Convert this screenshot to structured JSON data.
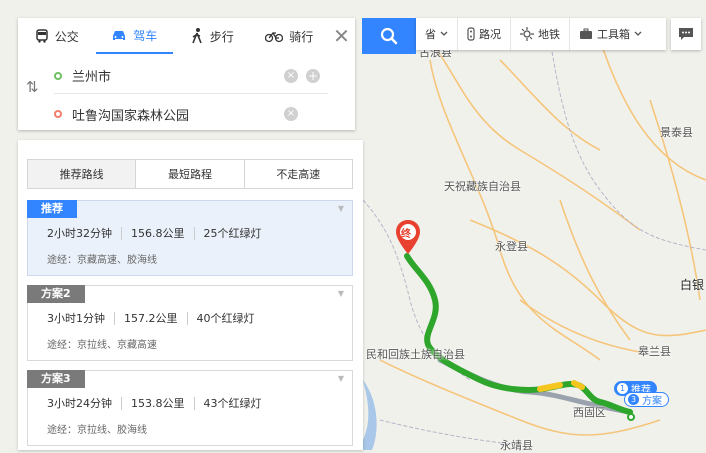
{
  "map": {
    "places": [
      {
        "name": "古浪县",
        "kind": "county"
      },
      {
        "name": "景泰县",
        "kind": "county"
      },
      {
        "name": "天祝藏族自治县",
        "kind": "county"
      },
      {
        "name": "永登县",
        "kind": "county"
      },
      {
        "name": "白银",
        "kind": "city"
      },
      {
        "name": "民和回族土族自治县",
        "kind": "county"
      },
      {
        "name": "皋兰县",
        "kind": "county"
      },
      {
        "name": "西固区",
        "kind": "district"
      },
      {
        "name": "永靖县",
        "kind": "county"
      }
    ],
    "end_marker": "终",
    "route_colors": {
      "route": "#2ea52b",
      "traffic": "#f6c51e",
      "alt_route": "#9aa3ad",
      "road": "#f5c57b",
      "boundary": "#b9b3c9"
    },
    "start_badge": {
      "number": "1",
      "label": "推荐"
    },
    "alt_badge": {
      "number": "3",
      "label": "方案"
    }
  },
  "search": {
    "modes": [
      {
        "label": "公交",
        "icon": "bus-icon"
      },
      {
        "label": "驾车",
        "icon": "car-icon",
        "active": true
      },
      {
        "label": "步行",
        "icon": "walk-icon"
      },
      {
        "label": "骑行",
        "icon": "bike-icon"
      }
    ],
    "start": "兰州市",
    "end": "吐鲁沟国家森林公园",
    "close": "✕",
    "swap": "⇅"
  },
  "toolbar": {
    "items": [
      {
        "label": "省",
        "icon": "chevron-down-icon"
      },
      {
        "label": "路况",
        "icon": "traffic-light-icon"
      },
      {
        "label": "地铁",
        "icon": "subway-icon"
      },
      {
        "label": "工具箱",
        "icon": "toolbox-icon"
      }
    ]
  },
  "results": {
    "sort_tabs": [
      "推荐路线",
      "最短路程",
      "不走高速"
    ],
    "plans": [
      {
        "tag": "推荐",
        "time": "2小时32分钟",
        "distance": "156.8公里",
        "lights": "25个红绿灯",
        "via": "途经：京藏高速、胶海线",
        "selected": true
      },
      {
        "tag": "方案2",
        "time": "3小时1分钟",
        "distance": "157.2公里",
        "lights": "40个红绿灯",
        "via": "途经：京拉线、京藏高速",
        "selected": false
      },
      {
        "tag": "方案3",
        "time": "3小时24分钟",
        "distance": "153.8公里",
        "lights": "43个红绿灯",
        "via": "途经：京拉线、胶海线",
        "selected": false
      }
    ]
  }
}
